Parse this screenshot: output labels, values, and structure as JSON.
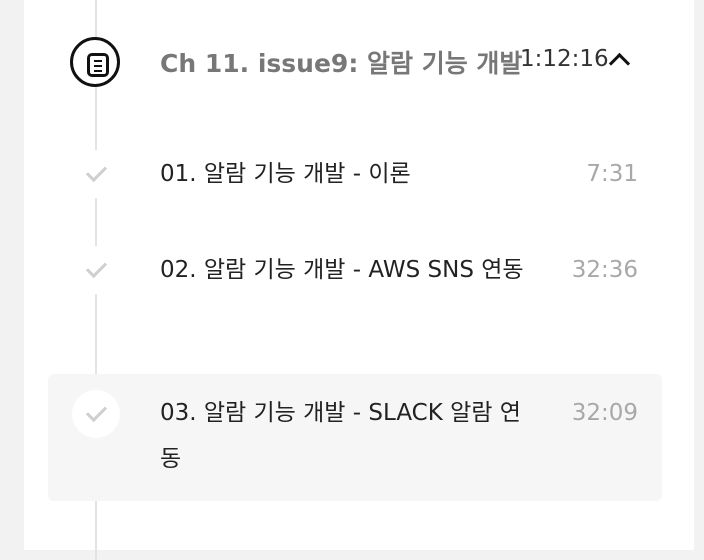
{
  "chapter": {
    "title": "Ch 11. issue9: 알람 기능 개발",
    "duration": "1:12:16",
    "icon": "document-icon",
    "expanded_icon": "chevron-up-icon"
  },
  "lessons": [
    {
      "title": "01. 알람 기능 개발 - 이론",
      "duration": "7:31",
      "completed": true,
      "active": false
    },
    {
      "title": "02. 알람 기능 개발 - AWS SNS 연동",
      "duration": "32:36",
      "completed": true,
      "active": false
    },
    {
      "title": "03. 알람 기능 개발 - SLACK 알람 연동",
      "duration": "32:09",
      "completed": true,
      "active": true
    }
  ],
  "colors": {
    "chapter_title": "#777777",
    "lesson_title": "#222222",
    "duration": "#a8a8a8",
    "active_bg": "#f6f6f6",
    "check": "#cfcfcf"
  }
}
